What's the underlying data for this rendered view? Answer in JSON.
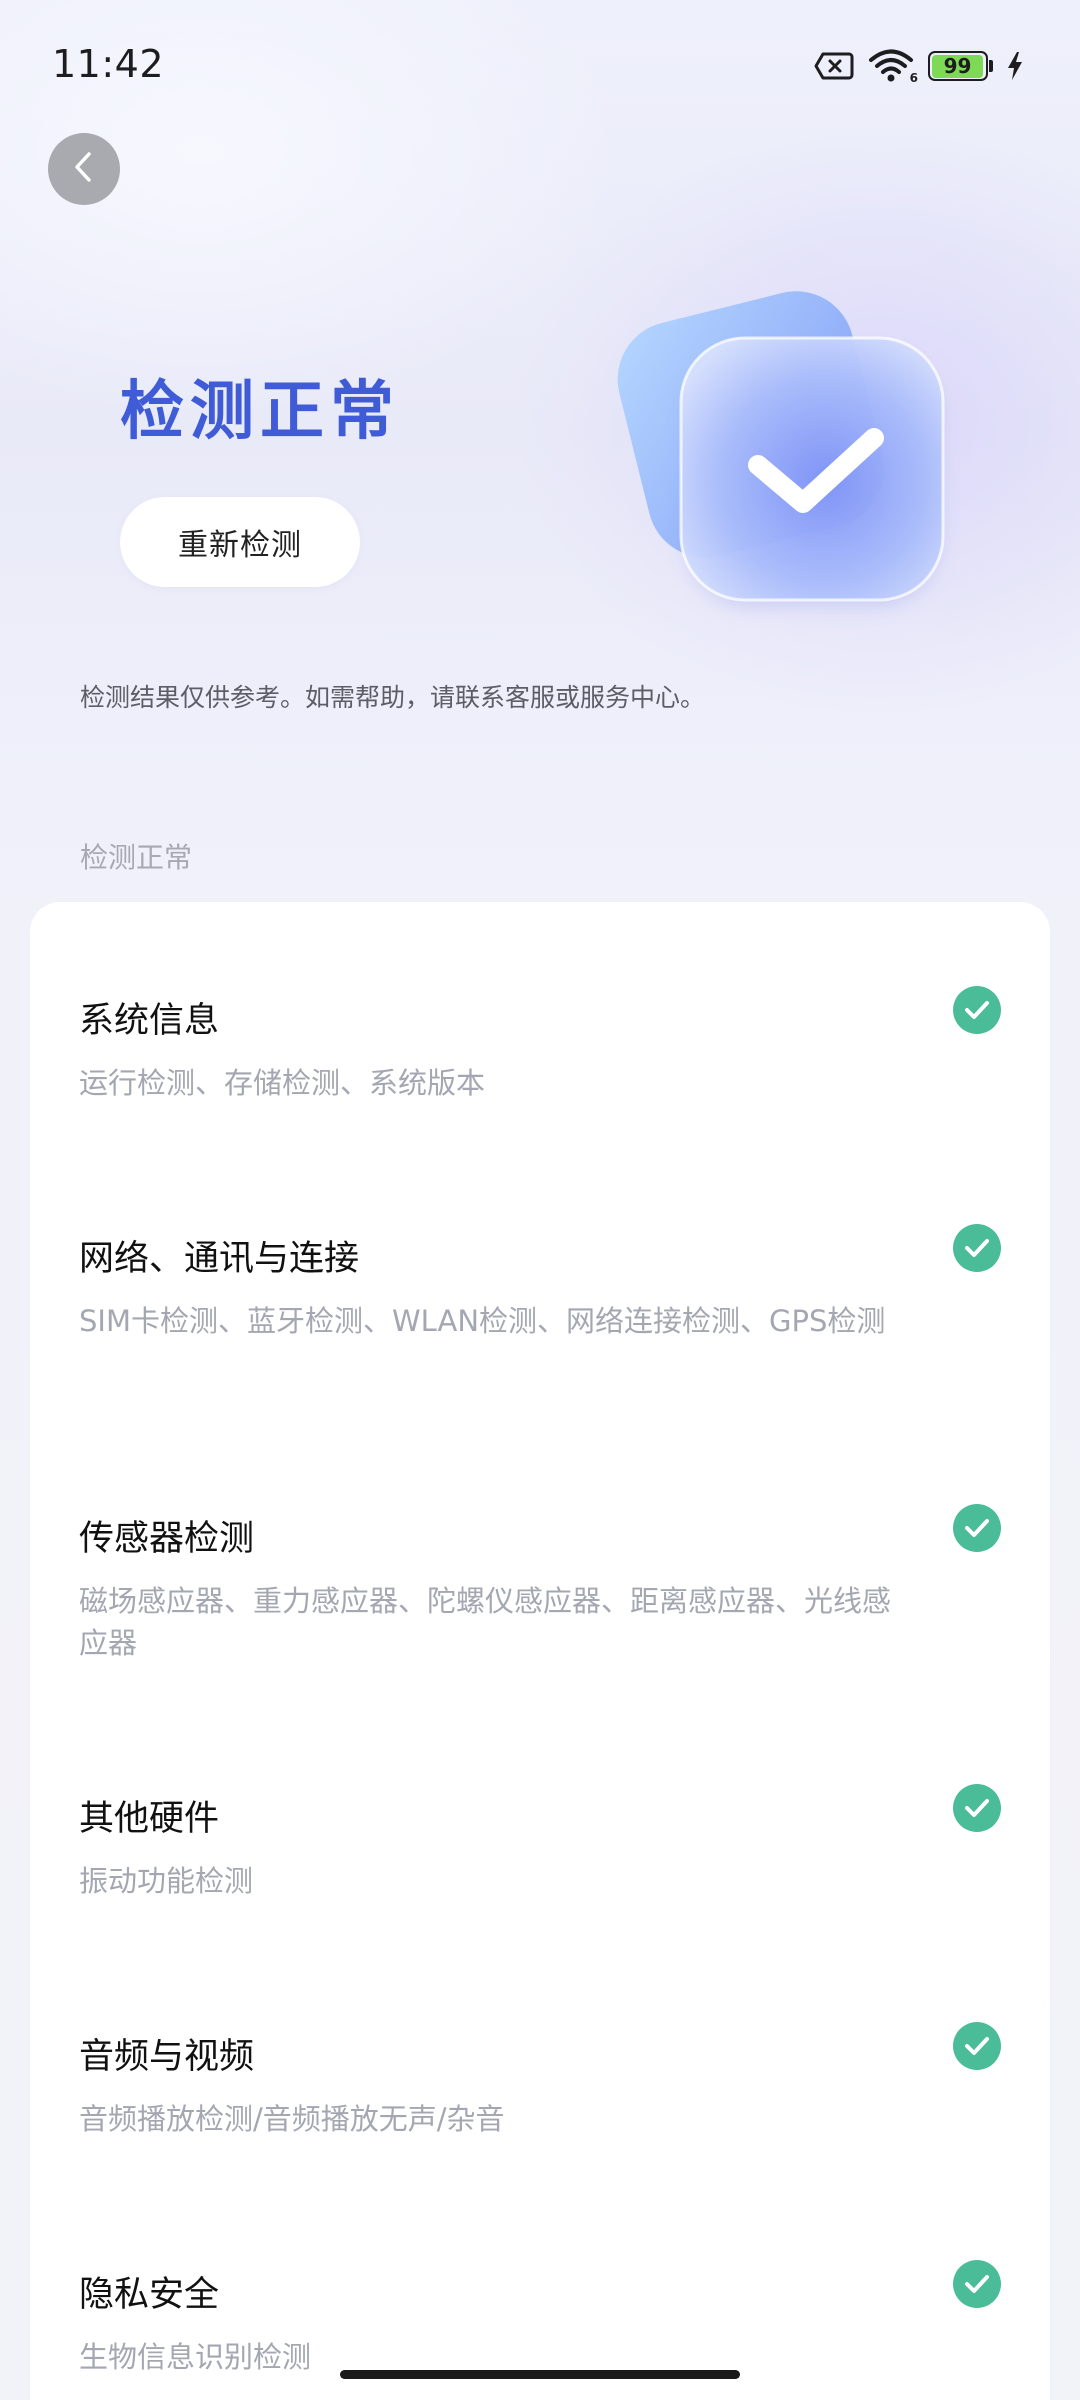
{
  "status_bar": {
    "time": "11:42",
    "icons": [
      "sim-off-icon",
      "wifi-icon",
      "battery-icon",
      "charging-bolt-icon"
    ],
    "battery_level": "99",
    "wifi_label": "6"
  },
  "header": {
    "back_icon": "chevron-left-icon"
  },
  "hero": {
    "title": "检测正常",
    "recheck_label": "重新检测",
    "illustration": "check-badge-icon",
    "accent_color": "#3f5bd6"
  },
  "disclaimer": "检测结果仅供参考。如需帮助，请联系客服或服务中心。",
  "section_label": "检测正常",
  "items": [
    {
      "title": "系统信息",
      "desc": "运行检测、存储检测、系统版本",
      "status": "ok"
    },
    {
      "title": "网络、通讯与连接",
      "desc": "SIM卡检测、蓝牙检测、WLAN检测、网络连接检测、GPS检测",
      "status": "ok"
    },
    {
      "title": "传感器检测",
      "desc": "磁场感应器、重力感应器、陀螺仪感应器、距离感应器、光线感应器",
      "status": "ok"
    },
    {
      "title": "其他硬件",
      "desc": "振动功能检测",
      "status": "ok"
    },
    {
      "title": "音频与视频",
      "desc": "音频播放检测/音频播放无声/杂音",
      "status": "ok"
    },
    {
      "title": "隐私安全",
      "desc": "生物信息识别检测",
      "status": "ok"
    }
  ],
  "status_ok_color": "#4bbc98"
}
